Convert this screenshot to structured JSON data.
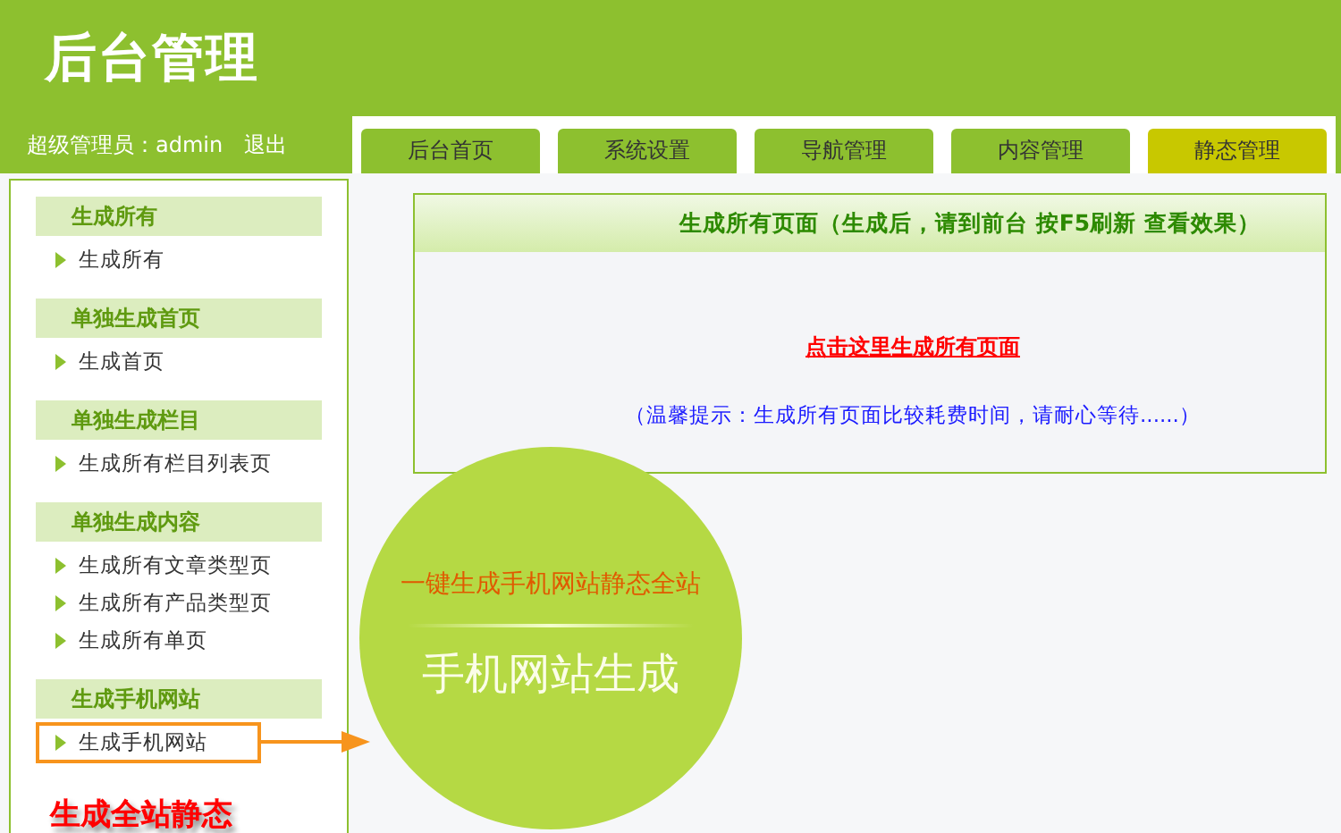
{
  "header": {
    "logo": "后台管理",
    "user": "超级管理员：admin",
    "logout": "退出"
  },
  "tabs": [
    {
      "label": "后台首页",
      "selected": false
    },
    {
      "label": "系统设置",
      "selected": false
    },
    {
      "label": "导航管理",
      "selected": false
    },
    {
      "label": "内容管理",
      "selected": false
    },
    {
      "label": "静态管理",
      "selected": true
    }
  ],
  "sidebar": {
    "groups": [
      {
        "title": "生成所有",
        "items": [
          {
            "label": "生成所有",
            "highlighted": false
          }
        ]
      },
      {
        "title": "单独生成首页",
        "items": [
          {
            "label": "生成首页",
            "highlighted": false
          }
        ]
      },
      {
        "title": "单独生成栏目",
        "items": [
          {
            "label": "生成所有栏目列表页",
            "highlighted": false
          }
        ]
      },
      {
        "title": "单独生成内容",
        "items": [
          {
            "label": "生成所有文章类型页",
            "highlighted": false
          },
          {
            "label": "生成所有产品类型页",
            "highlighted": false
          },
          {
            "label": "生成所有单页",
            "highlighted": false
          }
        ]
      },
      {
        "title": "生成手机网站",
        "items": [
          {
            "label": "生成手机网站",
            "highlighted": true
          }
        ]
      }
    ],
    "callout": "生成全站静态"
  },
  "panel": {
    "title": "生成所有页面（生成后，请到前台 按F5刷新 查看效果）",
    "link": "点击这里生成所有页面",
    "hint": "（温馨提示：生成所有页面比较耗费时间，请耐心等待......）"
  },
  "badge": {
    "tagline": "一键生成手机网站静态全站",
    "title": "手机网站生成"
  }
}
